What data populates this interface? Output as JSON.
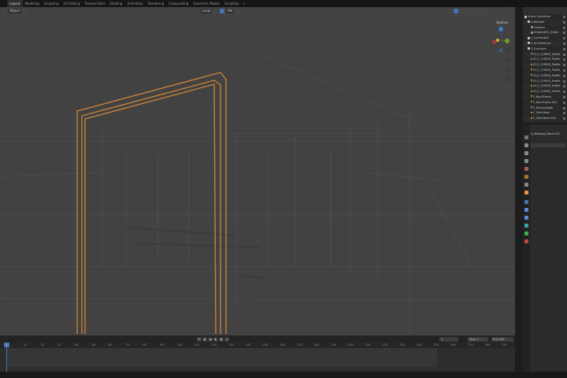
{
  "workspaces": [
    "Layout",
    "Modeling",
    "Sculpting",
    "UV Editing",
    "Texture Paint",
    "Shading",
    "Animation",
    "Rendering",
    "Compositing",
    "Geometry Nodes",
    "Scripting"
  ],
  "workspace_add": "+",
  "viewport_header": {
    "mode": "Object",
    "orientation": "Local",
    "pivot": "Me",
    "options": "Options"
  },
  "outliner": {
    "rows": [
      {
        "label": "Scene Collection",
        "icon": "collection",
        "color": "#bdbdbd"
      },
      {
        "label": "Collection",
        "icon": "collection",
        "color": "#bdbdbd"
      },
      {
        "label": "Camera",
        "icon": "camera",
        "color": "#7e8a8a"
      },
      {
        "label": "Empty.002_Origin",
        "icon": "empty",
        "color": "#8a8a8a"
      },
      {
        "label": "1_Landscape",
        "icon": "collection",
        "color": "#bdbdbd"
      },
      {
        "label": "2_Architecture",
        "icon": "collection",
        "color": "#bdbdbd"
      },
      {
        "label": "3_Furniture",
        "icon": "collection",
        "color": "#bdbdbd"
      },
      {
        "label": "03_F_CURVE_Profile",
        "icon": "curve",
        "color": "#e3a44a"
      },
      {
        "label": "03_F_CURVE_Profile",
        "icon": "curve",
        "color": "#e3a44a"
      },
      {
        "label": "03_F_CURVE_Profile",
        "icon": "curve",
        "color": "#e3a44a"
      },
      {
        "label": "03_F_CURVE_Profile",
        "icon": "curve",
        "color": "#e3a44a"
      },
      {
        "label": "03_F_CURVE_Profile",
        "icon": "curve",
        "color": "#e3a44a"
      },
      {
        "label": "03_F_CURVE_Profile",
        "icon": "curve",
        "color": "#e3a44a"
      },
      {
        "label": "03_F_CURVE_Profile",
        "icon": "curve",
        "color": "#e3a44a"
      },
      {
        "label": "03_F_CURVE_Profile",
        "icon": "curve",
        "color": "#e3a44a"
      },
      {
        "label": "F_Bed-Frame",
        "icon": "mesh",
        "color": "#e3a44a"
      },
      {
        "label": "F_Bed-Frame.002",
        "icon": "mesh",
        "color": "#e3a44a"
      },
      {
        "label": "F_Dining-Table",
        "icon": "mesh",
        "color": "#e3a44a"
      },
      {
        "label": "F_Sofa-Base",
        "icon": "mesh",
        "color": "#e3a44a"
      },
      {
        "label": "F_Sofa-Base.001",
        "icon": "mesh",
        "color": "#e3a44a"
      }
    ]
  },
  "properties": {
    "object_name": "A_Window_Base.001"
  },
  "timeline": {
    "current_frame": "1",
    "start_label": "Start",
    "start": "1",
    "end_label": "End",
    "end": "250",
    "ticks": [
      "1",
      "10",
      "20",
      "30",
      "40",
      "50",
      "60",
      "70",
      "80",
      "90",
      "100",
      "110",
      "120",
      "130",
      "140",
      "150",
      "160",
      "170",
      "180",
      "190",
      "200",
      "210",
      "220",
      "230",
      "240",
      "250",
      "260",
      "270",
      "280",
      "290"
    ]
  },
  "colors": {
    "accent": "#4772b3",
    "selection": "#e3a44a",
    "viewport_bg": "#424242"
  }
}
